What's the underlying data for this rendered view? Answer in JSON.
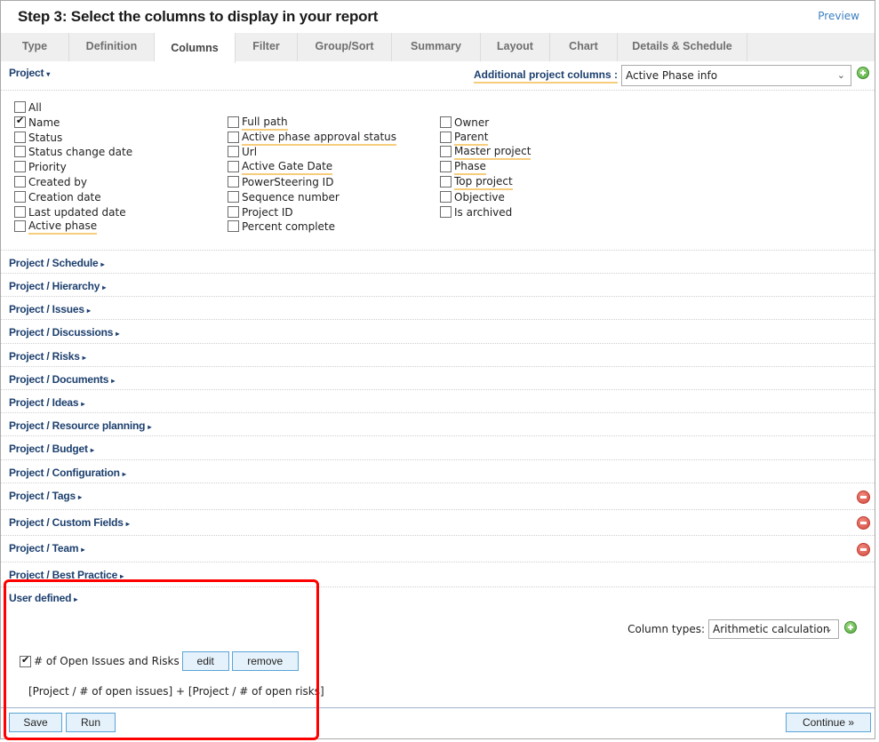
{
  "header": {
    "title": "Step 3: Select the columns to display in your report",
    "preview_link": "Preview"
  },
  "tabs": [
    {
      "label": "Type",
      "active": false
    },
    {
      "label": "Definition",
      "active": false
    },
    {
      "label": "Columns",
      "active": true
    },
    {
      "label": "Filter",
      "active": false
    },
    {
      "label": "Group/Sort",
      "active": false
    },
    {
      "label": "Summary",
      "active": false
    },
    {
      "label": "Layout",
      "active": false
    },
    {
      "label": "Chart",
      "active": false
    },
    {
      "label": "Details & Schedule",
      "active": false
    }
  ],
  "project_section": {
    "label": "Project",
    "caret": "▾",
    "additional_columns_label": "Additional project columns :",
    "additional_columns_selected": "Active Phase info",
    "add_icon": "plus-circle-icon",
    "checkbox_all": {
      "label": "All",
      "checked": false
    },
    "columns": [
      [
        {
          "label": "Name",
          "checked": true,
          "underlined": false
        },
        {
          "label": "Status",
          "checked": false,
          "underlined": false
        },
        {
          "label": "Status change date",
          "checked": false,
          "underlined": false
        },
        {
          "label": "Priority",
          "checked": false,
          "underlined": false
        },
        {
          "label": "Created by",
          "checked": false,
          "underlined": false
        },
        {
          "label": "Creation date",
          "checked": false,
          "underlined": false
        },
        {
          "label": "Last updated date",
          "checked": false,
          "underlined": false
        },
        {
          "label": "Active phase",
          "checked": false,
          "underlined": true
        }
      ],
      [
        {
          "label": "Full path",
          "checked": false,
          "underlined": true
        },
        {
          "label": "Active phase approval status",
          "checked": false,
          "underlined": true
        },
        {
          "label": "Url",
          "checked": false,
          "underlined": false
        },
        {
          "label": "Active Gate Date",
          "checked": false,
          "underlined": true
        },
        {
          "label": "PowerSteering ID",
          "checked": false,
          "underlined": false
        },
        {
          "label": "Sequence number",
          "checked": false,
          "underlined": false
        },
        {
          "label": "Project ID",
          "checked": false,
          "underlined": false
        },
        {
          "label": "Percent complete",
          "checked": false,
          "underlined": false
        }
      ],
      [
        {
          "label": "Owner",
          "checked": false,
          "underlined": false
        },
        {
          "label": "Parent",
          "checked": false,
          "underlined": true
        },
        {
          "label": "Master project",
          "checked": false,
          "underlined": true
        },
        {
          "label": "Phase",
          "checked": false,
          "underlined": true
        },
        {
          "label": "Top project",
          "checked": false,
          "underlined": true
        },
        {
          "label": "Objective",
          "checked": false,
          "underlined": false
        },
        {
          "label": "Is archived",
          "checked": false,
          "underlined": false
        }
      ]
    ]
  },
  "sections": [
    {
      "label": "Project / Schedule",
      "removable": false
    },
    {
      "label": "Project / Hierarchy",
      "removable": false
    },
    {
      "label": "Project / Issues",
      "removable": false
    },
    {
      "label": "Project / Discussions",
      "removable": false
    },
    {
      "label": "Project / Risks",
      "removable": false
    },
    {
      "label": "Project / Documents",
      "removable": false
    },
    {
      "label": "Project / Ideas",
      "removable": false
    },
    {
      "label": "Project / Resource planning",
      "removable": false
    },
    {
      "label": "Project / Budget",
      "removable": false
    },
    {
      "label": "Project / Configuration",
      "removable": false
    },
    {
      "label": "Project / Tags",
      "removable": true
    },
    {
      "label": "Project / Custom Fields",
      "removable": true
    },
    {
      "label": "Project / Team",
      "removable": true
    },
    {
      "label": "Project / Best Practice",
      "removable": false
    }
  ],
  "section_caret": "▸",
  "user_defined": {
    "label": "User defined",
    "column_types_label": "Column types:",
    "column_types_selected": "Arithmetic calculation",
    "field": {
      "label": "# of Open Issues and Risks",
      "checked": true,
      "edit_label": "edit",
      "remove_label": "remove",
      "formula": "[Project / # of open issues] + [Project / # of open risks]"
    }
  },
  "footer": {
    "save_label": "Save",
    "run_label": "Run",
    "continue_label": "Continue »"
  },
  "colors": {
    "link": "#1c3f6e",
    "accent_underline": "#f6cd7d",
    "button_bg": "#e6f2fb",
    "button_border": "#5aa4d6",
    "highlight": "#ff0000"
  }
}
